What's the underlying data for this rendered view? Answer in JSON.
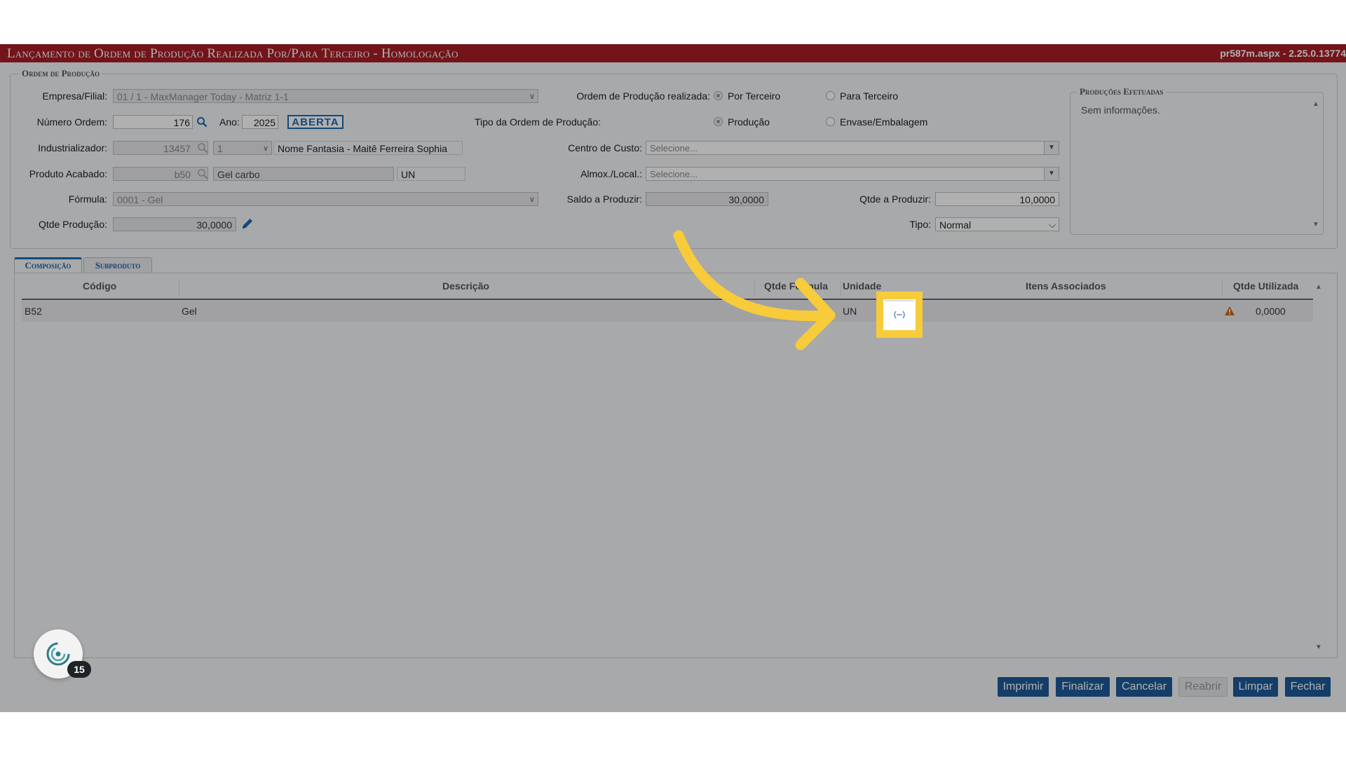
{
  "window": {
    "title": "Lançamento de Ordem de Produção Realizada Por/Para Terceiro  - Homologação",
    "version": "pr587m.aspx - 2.25.0.13774"
  },
  "ordem": {
    "legend": "Ordem de Produção",
    "empresa_label": "Empresa/Filial:",
    "empresa_value": "01 / 1 - MaxManager Today - Matriz 1-1",
    "numero_label": "Número Ordem:",
    "numero_value": "176",
    "ano_label": "Ano:",
    "ano_value": "2025",
    "status": "ABERTA",
    "industrializador_label": "Industrializador:",
    "industrializador_code": "13457",
    "industrializador_seq": "1",
    "industrializador_name": "Nome Fantasia - Maitê Ferreira Sophia",
    "produto_label": "Produto Acabado:",
    "produto_code": "b50",
    "produto_desc": "Gel carbo",
    "produto_unit": "UN",
    "formula_label": "Fórmula:",
    "formula_value": "0001 - Gel",
    "qtde_producao_label": "Qtde Produção:",
    "qtde_producao_value": "30,0000",
    "realizada_label": "Ordem de Produção realizada:",
    "realizada_options": [
      "Por Terceiro",
      "Para Terceiro"
    ],
    "tipo_ordem_label": "Tipo da Ordem de Produção:",
    "tipo_ordem_options": [
      "Produção",
      "Envase/Embalagem"
    ],
    "centro_label": "Centro de Custo:",
    "centro_placeholder": "Selecione...",
    "almox_label": "Almox./Local.:",
    "almox_placeholder": "Selecione...",
    "saldo_label": "Saldo a Produzir:",
    "saldo_value": "30,0000",
    "qtde_produzir_label": "Qtde a Produzir:",
    "qtde_produzir_value": "10,0000",
    "tipo_label": "Tipo:",
    "tipo_value": "Normal"
  },
  "producoes": {
    "legend": "Produções Efetuadas",
    "empty": "Sem informações."
  },
  "tabs": [
    "Composição",
    "Subproduto"
  ],
  "grid": {
    "headers": [
      "Código",
      "Descrição",
      "Qtde Fórmula",
      "Unidade",
      "Itens Associados",
      "Qtde Utilizada"
    ],
    "rows": [
      {
        "codigo": "B52",
        "descricao": "Gel",
        "unidade": "UN",
        "qtde_utilizada": "0,0000"
      }
    ]
  },
  "buttons": [
    "Imprimir",
    "Finalizar",
    "Cancelar",
    "Reabrir",
    "Limpar",
    "Fechar"
  ],
  "widget": {
    "count": "15"
  },
  "colors": {
    "titlebar": "#a51d26",
    "button": "#1e5a99",
    "highlight": "#f7cb3a",
    "accent": "#1e6ab0"
  }
}
